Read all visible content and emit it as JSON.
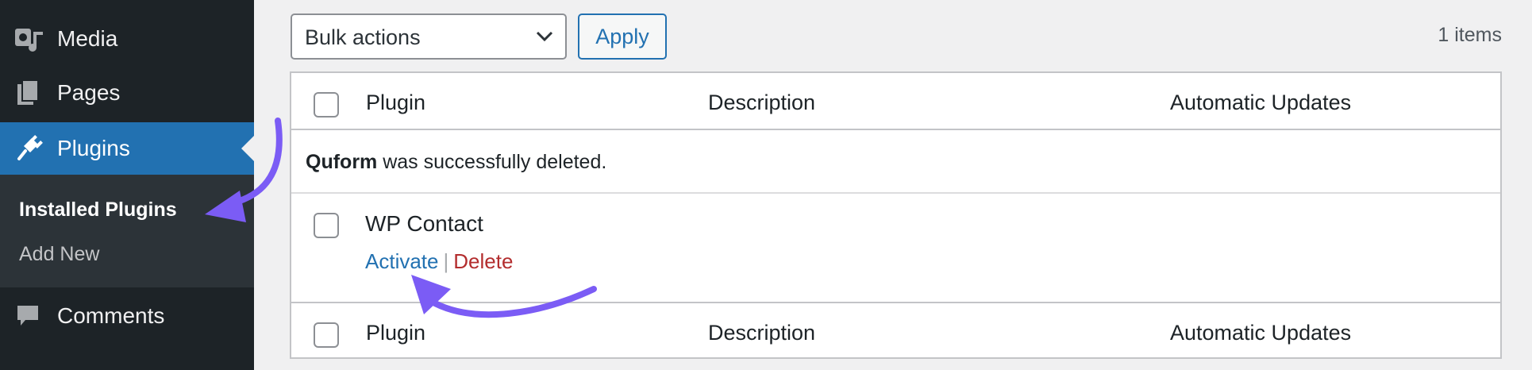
{
  "sidebar": {
    "items": [
      {
        "label": "Media",
        "icon": "media-icon"
      },
      {
        "label": "Pages",
        "icon": "pages-icon"
      },
      {
        "label": "Plugins",
        "icon": "plugin-icon"
      },
      {
        "label": "Comments",
        "icon": "comments-icon"
      }
    ],
    "submenu": [
      {
        "label": "Installed Plugins"
      },
      {
        "label": "Add New"
      }
    ],
    "active_color": "#2271b1",
    "background_color": "#1d2327"
  },
  "toolbar": {
    "bulk_actions_value": "Bulk actions",
    "apply_label": "Apply",
    "items_count": "1 items"
  },
  "table": {
    "columns": [
      "Plugin",
      "Description",
      "Automatic Updates"
    ],
    "notice": {
      "plugin_name": "Quform",
      "text": " was successfully deleted."
    },
    "rows": [
      {
        "name": "WP Contact",
        "actions": {
          "activate": "Activate",
          "separator": "|",
          "delete": "Delete"
        }
      }
    ]
  },
  "annotation": {
    "arrow_color": "#7b5cf5"
  }
}
